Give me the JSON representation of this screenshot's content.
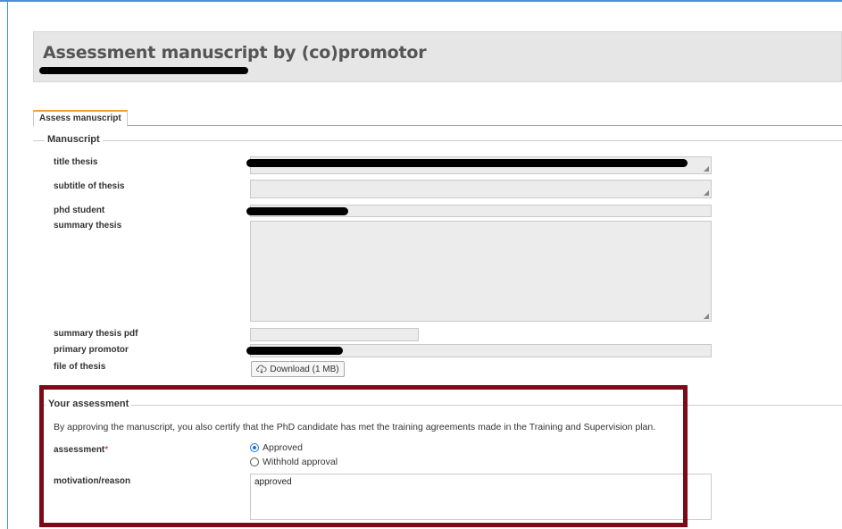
{
  "header": {
    "title": "Assessment manuscript by (co)promotor"
  },
  "tabs": [
    {
      "label": "Assess manuscript",
      "active": true
    }
  ],
  "manuscript": {
    "legend": "Manuscript",
    "labels": {
      "title_thesis": "title thesis",
      "subtitle_thesis": "subtitle of thesis",
      "phd_student": "phd student",
      "summary_thesis": "summary thesis",
      "summary_thesis_pdf": "summary thesis pdf",
      "primary_promotor": "primary promotor",
      "file_of_thesis": "file of thesis"
    },
    "download_label": "Download (1 MB)"
  },
  "assessment": {
    "legend": "Your assessment",
    "info": "By approving the manuscript, you also certify that the PhD candidate has met the training agreements made in the Training and Supervision plan.",
    "assessment_label": "assessment",
    "required_marker": "*",
    "options": [
      {
        "label": "Approved",
        "checked": true
      },
      {
        "label": "Withhold approval",
        "checked": false
      }
    ],
    "motivation_label": "motivation/reason",
    "motivation_value": "approved"
  },
  "colors": {
    "highlight_border": "#7d0a18",
    "tab_accent": "#f0a030",
    "radio_accent": "#1a73e8"
  }
}
